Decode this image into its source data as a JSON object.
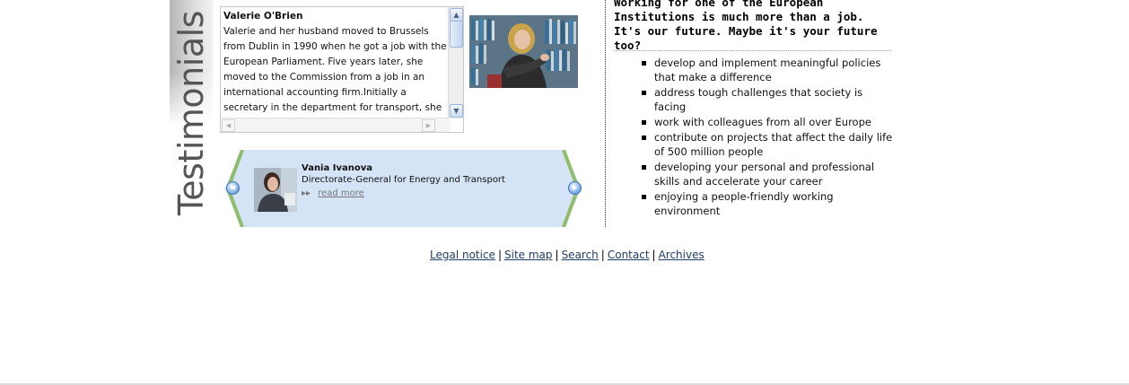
{
  "testimonials": {
    "heading": "Testimonials",
    "story": {
      "name": "Valerie O'Brien",
      "text": "Valerie and her husband moved to Brussels from Dublin in 1990 when he got a job with the European Parliament. Five years later, she moved to the Commission from a job in an international accounting firm.Initially a secretary in the department for transport, she then sought a job"
    },
    "carousel": {
      "person_name": "Vania Ivanova",
      "department": "Directorate-General for Energy and Transport",
      "read_more_label": "read more",
      "read_more_bullet": "▸▸"
    }
  },
  "career": {
    "headline": "Working for one of the European Institutions is much more than a job. It's our future. Maybe it's your future too?",
    "benefits": [
      "develop and implement meaningful policies that make a difference",
      "address tough challenges that society is facing",
      "work with colleagues from all over Europe",
      "contribute on projects that affect the daily life of 500 million people",
      "developing your personal and professional skills and accelerate your career",
      "enjoying a people-friendly working environment"
    ]
  },
  "footer": {
    "links": [
      "Legal notice",
      "Site map",
      "Search",
      "Contact",
      "Archives"
    ],
    "separator": "|"
  }
}
